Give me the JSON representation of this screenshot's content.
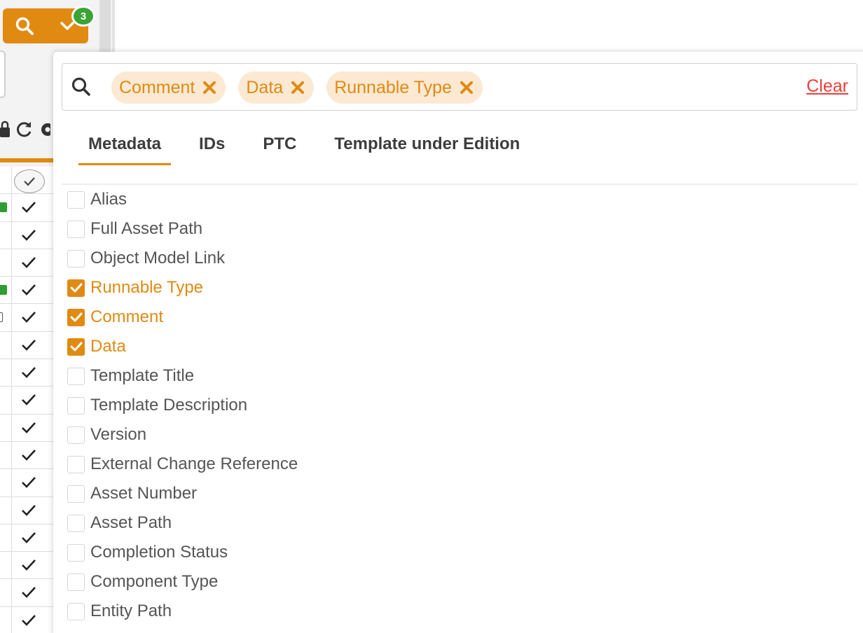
{
  "search_toggle": {
    "badge_count": "3"
  },
  "filter_bar": {
    "chips": [
      {
        "label": "Comment"
      },
      {
        "label": "Data"
      },
      {
        "label": "Runnable Type"
      }
    ],
    "clear_label": "Clear"
  },
  "tabs": [
    {
      "label": "Metadata",
      "active": true
    },
    {
      "label": "IDs",
      "active": false
    },
    {
      "label": "PTC",
      "active": false
    },
    {
      "label": "Template under Edition",
      "active": false
    }
  ],
  "options": [
    {
      "label": "Alias",
      "checked": false
    },
    {
      "label": "Full Asset Path",
      "checked": false
    },
    {
      "label": "Object Model Link",
      "checked": false
    },
    {
      "label": "Runnable Type",
      "checked": true
    },
    {
      "label": "Comment",
      "checked": true
    },
    {
      "label": "Data",
      "checked": true
    },
    {
      "label": "Template Title",
      "checked": false
    },
    {
      "label": "Template Description",
      "checked": false
    },
    {
      "label": "Version",
      "checked": false
    },
    {
      "label": "External Change Reference",
      "checked": false
    },
    {
      "label": "Asset Number",
      "checked": false
    },
    {
      "label": "Asset Path",
      "checked": false
    },
    {
      "label": "Completion Status",
      "checked": false
    },
    {
      "label": "Component Type",
      "checked": false
    },
    {
      "label": "Entity Path",
      "checked": false
    }
  ],
  "colors": {
    "accent": "#e08a12",
    "chip_bg": "#fbe9d3",
    "clear_link": "#e8413a",
    "badge": "#3aa435"
  },
  "background_grid": {
    "row_markers": [
      "green",
      "",
      "",
      "green",
      "box",
      "",
      "",
      "",
      "",
      "",
      "",
      "",
      "",
      "",
      "",
      ""
    ]
  }
}
